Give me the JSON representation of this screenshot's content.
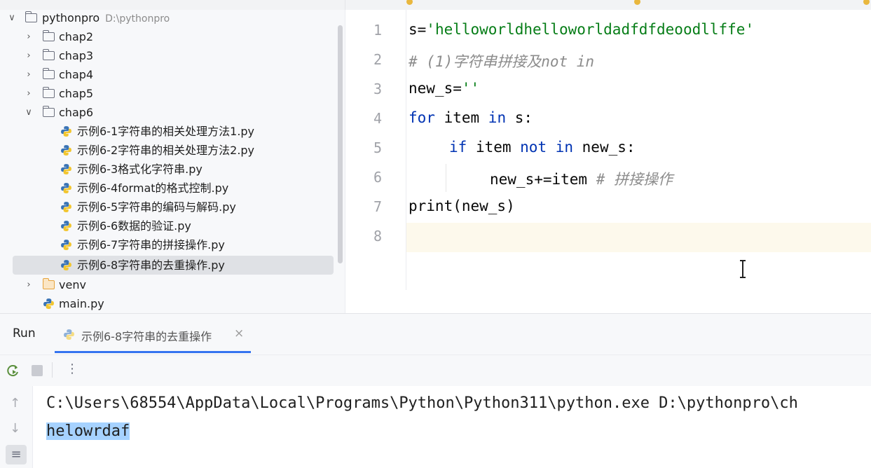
{
  "project_tree": {
    "root": {
      "name": "pythonpro",
      "path": "D:\\pythonpro"
    },
    "items": [
      {
        "label": "chap2"
      },
      {
        "label": "chap3"
      },
      {
        "label": "chap4"
      },
      {
        "label": "chap5"
      },
      {
        "label": "chap6"
      },
      {
        "label": "示例6-1字符串的相关处理方法1.py"
      },
      {
        "label": "示例6-2字符串的相关处理方法2.py"
      },
      {
        "label": "示例6-3格式化字符串.py"
      },
      {
        "label": "示例6-4format的格式控制.py"
      },
      {
        "label": "示例6-5字符串的编码与解码.py"
      },
      {
        "label": "示例6-6数据的验证.py"
      },
      {
        "label": "示例6-7字符串的拼接操作.py"
      },
      {
        "label": "示例6-8字符串的去重操作.py"
      },
      {
        "label": "venv"
      },
      {
        "label": "main.py"
      }
    ]
  },
  "editor": {
    "line_numbers": [
      "1",
      "2",
      "3",
      "4",
      "5",
      "6",
      "7",
      "8"
    ],
    "lines": {
      "l1_var": "s=",
      "l1_str": "'helloworldhelloworldadfdfdeoodllffe'",
      "l2_cmt": "# (1)字符串拼接及not in",
      "l3_var": "new_s=",
      "l3_str": "''",
      "l4_kw1": "for",
      "l4_mid": " item ",
      "l4_kw2": "in",
      "l4_end": " s:",
      "l5_kw1": "if",
      "l5_mid": " item ",
      "l5_kw2": "not in",
      "l5_end": " new_s:",
      "l6_code": "new_s+=item ",
      "l6_cmt": "# 拼接操作",
      "l7_code": "print(new_s)"
    }
  },
  "run_panel": {
    "title": "Run",
    "tab_label": "示例6-8字符串的去重操作",
    "console": [
      "C:\\Users\\68554\\AppData\\Local\\Programs\\Python\\Python311\\python.exe D:\\pythonpro\\ch",
      "helowrdaf"
    ]
  },
  "colors": {
    "keyword": "#0033b3",
    "string": "#067d17",
    "comment": "#8c8c8c",
    "selection": "#a6d2ff",
    "accent": "#3574f0"
  }
}
